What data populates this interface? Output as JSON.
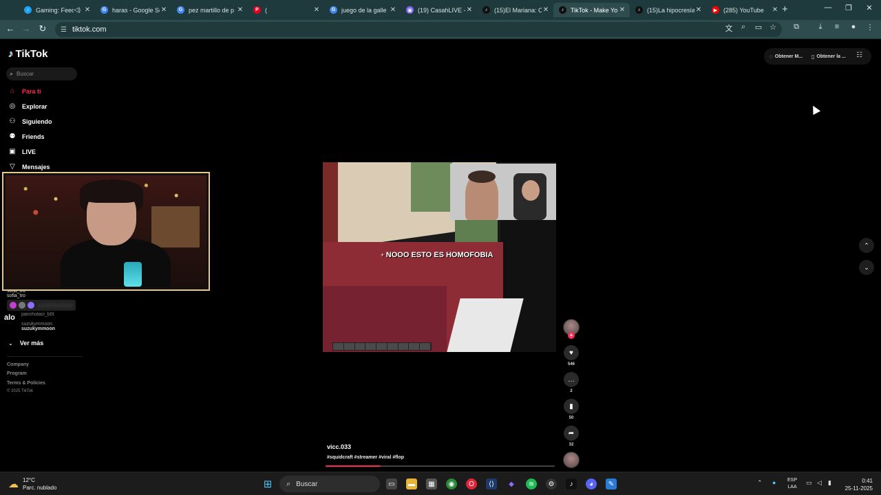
{
  "browser": {
    "tabs": [
      {
        "label": "Gaming: Feed",
        "fav_color": "#1da1f2",
        "fav_glyph": "♪",
        "sound": true
      },
      {
        "label": "haras - Google Se",
        "fav_color": "#4285f4",
        "fav_glyph": "G"
      },
      {
        "label": "pez martillo de p",
        "fav_color": "#4285f4",
        "fav_glyph": "G"
      },
      {
        "label": "(",
        "fav_color": "#e60023",
        "fav_glyph": "P"
      },
      {
        "label": "juego de la galle",
        "fav_color": "#4285f4",
        "fav_glyph": "G"
      },
      {
        "label": "(19) CasahLIVE -",
        "fav_color": "#7b68ee",
        "fav_glyph": "▣"
      },
      {
        "label": "(15)El Mariana: C",
        "fav_color": "#111111",
        "fav_glyph": "♪"
      },
      {
        "label": "TikTok - Make Yo",
        "fav_color": "#111111",
        "fav_glyph": "♪",
        "active": true
      },
      {
        "label": "(15)La hipocresía",
        "fav_color": "#111111",
        "fav_glyph": "♪"
      },
      {
        "label": "(285) YouTube",
        "fav_color": "#ff0000",
        "fav_glyph": "▶"
      }
    ],
    "url": "tiktok.com"
  },
  "sidebar": {
    "logo": "TikTok",
    "search_placeholder": "Buscar",
    "nav": [
      {
        "label": "Para ti",
        "icon": "home-icon"
      },
      {
        "label": "Explorar",
        "icon": "compass-icon"
      },
      {
        "label": "Siguiendo",
        "icon": "following-icon"
      },
      {
        "label": "Friends",
        "icon": "friends-icon"
      },
      {
        "label": "LIVE",
        "icon": "live-icon"
      },
      {
        "label": "Mensajes",
        "icon": "messages-icon"
      }
    ],
    "followed": [
      {
        "line1": "sofia_tro",
        "line2": "sofia_tro"
      },
      {
        "line1": "panchotaci_b0t",
        "line2": ""
      },
      {
        "line1": "suzukymmoon",
        "line2": "suzukymmoon"
      }
    ],
    "see_more": "Ver más",
    "footer": [
      "Company",
      "Program",
      "Terms & Policies",
      "© 2025 TikTok"
    ]
  },
  "overlay": {
    "streamer_name": "nedcbroken",
    "chat_text": "alo"
  },
  "topbar": {
    "pill1": "Obtener M...",
    "pill2": "Obtener la ..."
  },
  "video": {
    "caption_overlay": "NOOO ESTO ES HOMOFOBIA",
    "author": "vicc.033",
    "hashtags": "#squidcraft #streamer #viral #flop",
    "progress": 0.24,
    "likes": "546",
    "comments": "2",
    "saves": "50",
    "shares": "32"
  },
  "taskbar": {
    "temperature": "12°C",
    "weather": "Parc. nublado",
    "search": "Buscar",
    "lang1": "ESP",
    "lang2": "LAA",
    "time": "0:41",
    "date": "25-11-2025"
  },
  "colors": {
    "accent": "#fe2c55",
    "browser_frame": "#1e3a3c"
  }
}
